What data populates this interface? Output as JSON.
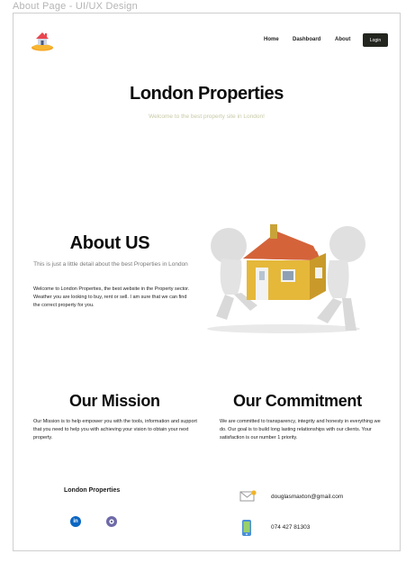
{
  "frame_title": "About Page - UI/UX Design",
  "nav": {
    "items": [
      "Home",
      "Dashboard",
      "About"
    ],
    "login_label": "Login"
  },
  "hero": {
    "title": "London Properties",
    "subtitle": "Welcome to the best property site in London!"
  },
  "about": {
    "title": "About US",
    "subtitle": "This is just a little detail about the best Properties in London",
    "body": "Welcome to London Properties, the best website in the Property sector. Weather you are looking to buy, rent or sell. I am sure that we can find the correct property for you."
  },
  "mission": {
    "title": "Our Mission",
    "body": "Our Mission is to help empower you with the tools, information and support that you need to help you with achieving your vision to obtain your next property."
  },
  "commitment": {
    "title": "Our Commitment",
    "body": "We are committed to transparency, integrity and honesty in everything we do. Our goal is to build long lasting relationships with our clients. Your satisfaction is our number 1 priority."
  },
  "footer": {
    "brand": "London Properties",
    "email": "douglasmaxton@gmail.com",
    "phone": "074 427 81303",
    "icons": [
      "linkedin-icon",
      "github-icon",
      "mail-icon",
      "phone-icon"
    ]
  },
  "colors": {
    "login_bg": "#23251f",
    "subtitle": "#c7c9a5",
    "linkedin": "#0a66c2",
    "github": "#6e6aa8"
  }
}
